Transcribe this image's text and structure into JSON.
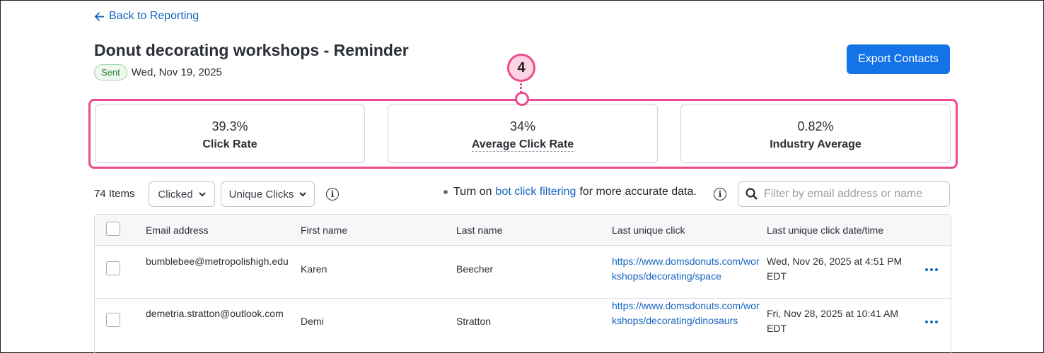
{
  "nav": {
    "back_label": "Back to Reporting"
  },
  "header": {
    "title": "Donut decorating workshops - Reminder",
    "status_badge": "Sent",
    "sent_date": "Wed, Nov 19, 2025",
    "export_label": "Export Contacts"
  },
  "callout": {
    "number": "4",
    "color": "#ec4b8e"
  },
  "stats": [
    {
      "value": "39.3%",
      "label": "Click Rate"
    },
    {
      "value": "34%",
      "label": "Average Click Rate"
    },
    {
      "value": "0.82%",
      "label": "Industry Average"
    }
  ],
  "toolbar": {
    "count": "74 Items",
    "filter_type": "Clicked",
    "click_mode": "Unique Clicks",
    "bot_prefix": "Turn on",
    "bot_link": "bot click filtering",
    "bot_suffix": "for more accurate data.",
    "search_placeholder": "Filter by email address or name"
  },
  "table": {
    "columns": [
      "Email address",
      "First name",
      "Last name",
      "Last unique click",
      "Last unique click date/time"
    ],
    "rows": [
      {
        "email": "bumblebee@metropolishigh.edu",
        "first": "Karen",
        "last": "Beecher",
        "link": "https://www.domsdonuts.com/workshops/decorating/space",
        "datetime": "Wed, Nov 26, 2025 at 4:51 PM EDT"
      },
      {
        "email": "demetria.stratton@outlook.com",
        "first": "Demi",
        "last": "Stratton",
        "link": "https://www.domsdonuts.com/workshops/decorating/dinosaurs",
        "datetime": "Fri, Nov 28, 2025 at 10:41 AM EDT"
      }
    ]
  },
  "colors": {
    "accent": "#1473e6",
    "link": "#1565c0",
    "highlight": "#ec4b8e",
    "success": "#2e7d32"
  },
  "icons": [
    "arrow-left-icon",
    "chevron-down-icon",
    "info-icon",
    "search-icon",
    "more-options-icon"
  ]
}
